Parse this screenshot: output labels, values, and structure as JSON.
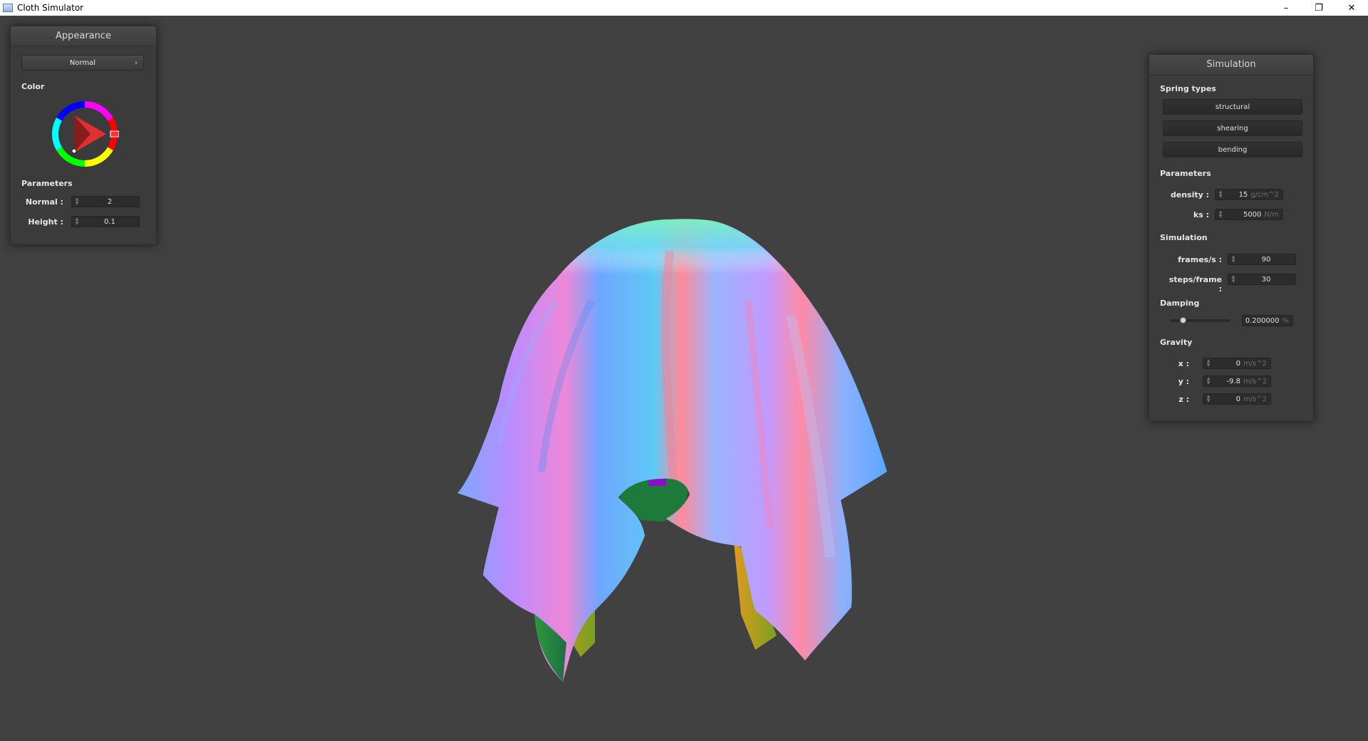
{
  "window": {
    "title": "Cloth Simulator",
    "controls": {
      "minimize": "–",
      "restore": "❐",
      "close": "✕"
    }
  },
  "appearance": {
    "header": "Appearance",
    "mode": "Normal",
    "color_label": "Color",
    "selected_color": "#e63232",
    "parameters_label": "Parameters",
    "normal_label": "Normal :",
    "normal_value": "2",
    "height_label": "Height :",
    "height_value": "0.1"
  },
  "simulation": {
    "header": "Simulation",
    "spring_types_label": "Spring types",
    "spring_types": [
      "structural",
      "shearing",
      "bending"
    ],
    "parameters_label": "Parameters",
    "density_label": "density :",
    "density_value": "15",
    "density_unit": "g/cm^2",
    "ks_label": "ks :",
    "ks_value": "5000",
    "ks_unit": "N/m",
    "sim_label": "Simulation",
    "fps_label": "frames/s :",
    "fps_value": "90",
    "steps_label": "steps/frame :",
    "steps_value": "30",
    "damping_label": "Damping",
    "damping_value": "0.200000",
    "damping_unit": "%",
    "damping_fraction": 0.2,
    "gravity_label": "Gravity",
    "gx_label": "x :",
    "gx_value": "0",
    "gy_label": "y :",
    "gy_value": "-9.8",
    "gz_label": "z :",
    "gz_value": "0",
    "g_unit": "m/s^2"
  }
}
